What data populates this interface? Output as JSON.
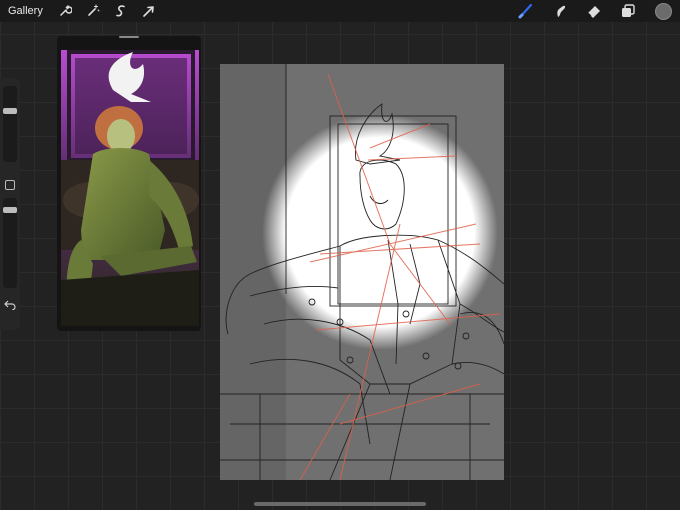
{
  "topbar": {
    "gallery_label": "Gallery",
    "left_tools": [
      "wrench-icon",
      "magic-wand-icon",
      "selection-icon",
      "transform-icon"
    ],
    "right_tools": [
      "brush-icon",
      "smudge-icon",
      "eraser-icon",
      "layers-icon"
    ],
    "active_tool": "brush-icon",
    "accent_color": "#2b6cf0",
    "current_color": "#6b6b6b"
  },
  "sidebar": {
    "items": [
      "brush-size-slider",
      "modify-button",
      "opacity-slider",
      "undo-icon"
    ]
  },
  "reference": {
    "tint_top": "#b84dd0",
    "tint_bottom": "#7a8a3a"
  },
  "canvas": {
    "background": "#707070",
    "spotlight": "#ffffff",
    "sketch_line_color": "#222222",
    "guide_line_color": "#e0604a"
  }
}
